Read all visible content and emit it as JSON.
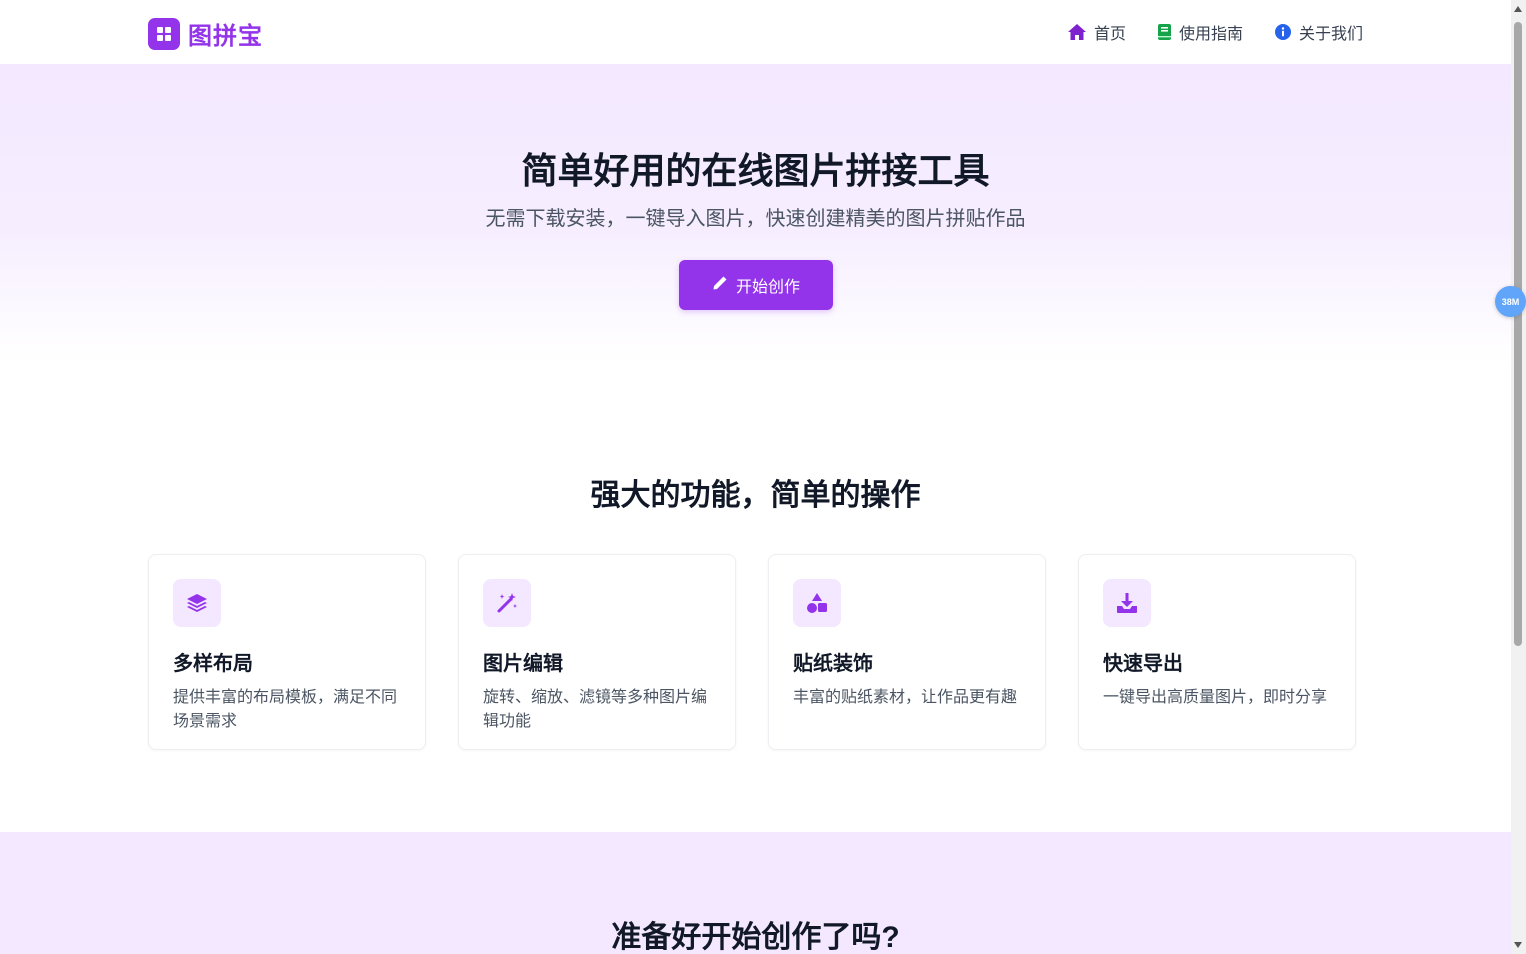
{
  "header": {
    "brand": "图拼宝",
    "nav": [
      {
        "label": "首页",
        "icon": "home-icon",
        "color": "#7e22ce"
      },
      {
        "label": "使用指南",
        "icon": "book-icon",
        "color": "#16a34a"
      },
      {
        "label": "关于我们",
        "icon": "info-icon",
        "color": "#2563eb"
      }
    ]
  },
  "hero": {
    "title": "简单好用的在线图片拼接工具",
    "subtitle": "无需下载安装，一键导入图片，快速创建精美的图片拼贴作品",
    "cta_label": "开始创作"
  },
  "features": {
    "title": "强大的功能，简单的操作",
    "items": [
      {
        "icon": "layers-icon",
        "title": "多样布局",
        "desc": "提供丰富的布局模板，满足不同场景需求"
      },
      {
        "icon": "magic-wand-icon",
        "title": "图片编辑",
        "desc": "旋转、缩放、滤镜等多种图片编辑功能"
      },
      {
        "icon": "shapes-icon",
        "title": "贴纸装饰",
        "desc": "丰富的贴纸素材，让作品更有趣"
      },
      {
        "icon": "download-icon",
        "title": "快速导出",
        "desc": "一键导出高质量图片，即时分享"
      }
    ]
  },
  "bottom_cta": {
    "title": "准备好开始创作了吗?"
  },
  "floating_badge": "38M",
  "colors": {
    "accent": "#9333ea",
    "accent_light": "#f3e8ff"
  }
}
